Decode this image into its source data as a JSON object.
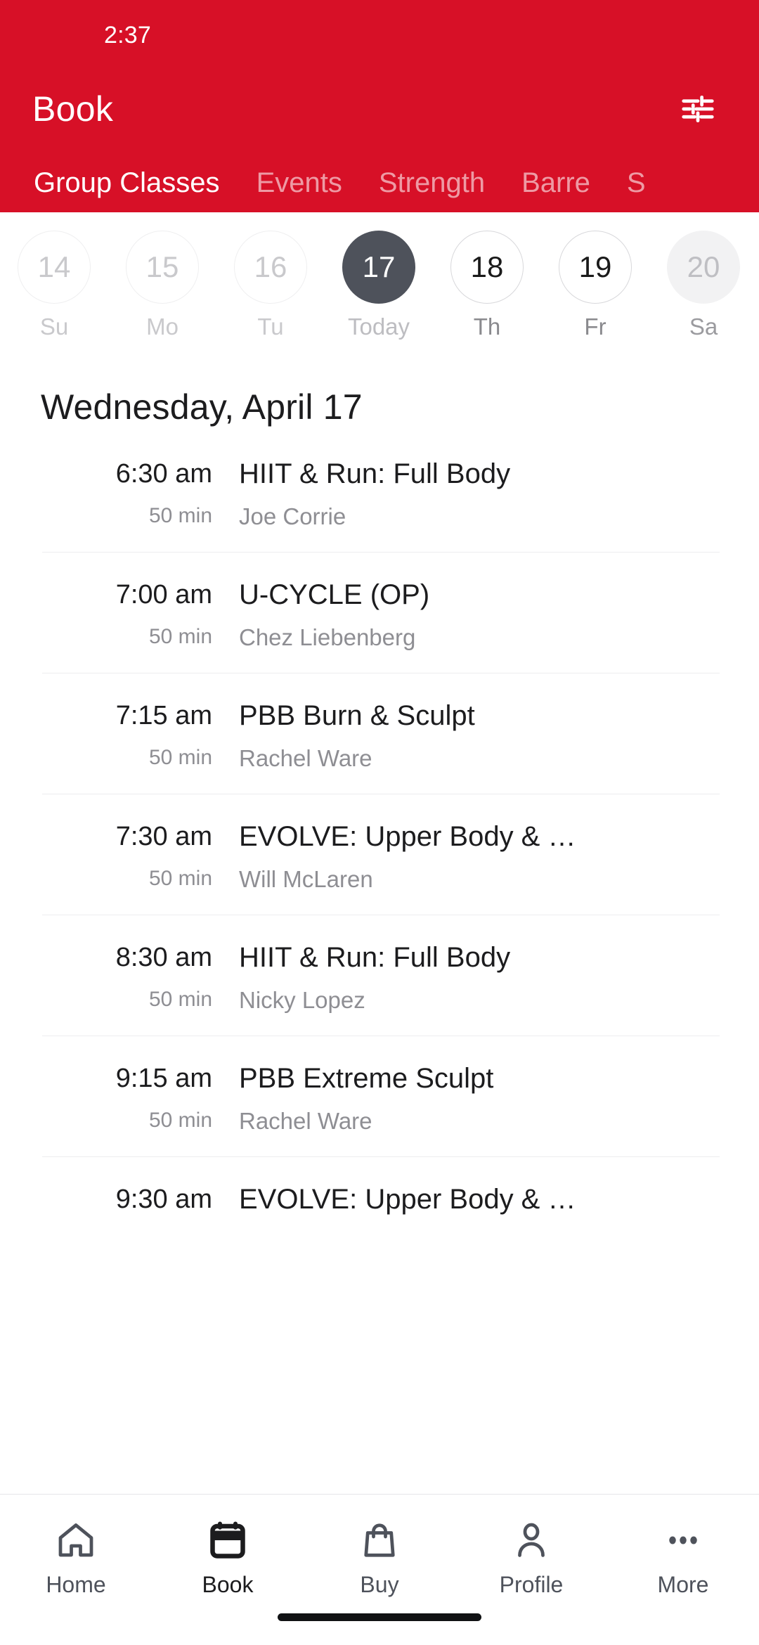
{
  "theme": {
    "brand_red": "#D71027",
    "selected_day": "#4E525B",
    "text_primary": "#1C1C1E",
    "text_secondary": "#8E8E93",
    "divider": "#EDEDEF"
  },
  "status_bar": {
    "time": "2:37"
  },
  "header": {
    "title": "Book",
    "filter_icon": "tune-icon",
    "tabs": [
      {
        "label": "Group Classes",
        "active": true
      },
      {
        "label": "Events",
        "active": false
      },
      {
        "label": "Strength",
        "active": false
      },
      {
        "label": "Barre",
        "active": false
      },
      {
        "label": "S",
        "active": false
      }
    ]
  },
  "date_strip": [
    {
      "date": "14",
      "weekday": "Su",
      "state": "past"
    },
    {
      "date": "15",
      "weekday": "Mo",
      "state": "past"
    },
    {
      "date": "16",
      "weekday": "Tu",
      "state": "past"
    },
    {
      "date": "17",
      "weekday": "Today",
      "state": "selected"
    },
    {
      "date": "18",
      "weekday": "Th",
      "state": "future"
    },
    {
      "date": "19",
      "weekday": "Fr",
      "state": "future"
    },
    {
      "date": "20",
      "weekday": "Sa",
      "state": "disabled"
    }
  ],
  "schedule": {
    "day_title": "Wednesday, April 17",
    "classes": [
      {
        "time": "6:30 am",
        "duration": "50 min",
        "name": "HIIT & Run: Full Body",
        "instructor": "Joe Corrie"
      },
      {
        "time": "7:00 am",
        "duration": "50 min",
        "name": "U-CYCLE (OP)",
        "instructor": "Chez Liebenberg"
      },
      {
        "time": "7:15 am",
        "duration": "50 min",
        "name": "PBB Burn & Sculpt",
        "instructor": "Rachel Ware"
      },
      {
        "time": "7:30 am",
        "duration": "50 min",
        "name": "EVOLVE: Upper Body & …",
        "instructor": "Will McLaren"
      },
      {
        "time": "8:30 am",
        "duration": "50 min",
        "name": "HIIT & Run: Full Body",
        "instructor": "Nicky Lopez"
      },
      {
        "time": "9:15 am",
        "duration": "50 min",
        "name": "PBB Extreme Sculpt",
        "instructor": "Rachel Ware"
      },
      {
        "time": "9:30 am",
        "duration": "",
        "name": "EVOLVE: Upper Body & …",
        "instructor": ""
      }
    ]
  },
  "bottom_nav": [
    {
      "label": "Home",
      "icon": "home-icon",
      "active": false
    },
    {
      "label": "Book",
      "icon": "calendar-icon",
      "active": true
    },
    {
      "label": "Buy",
      "icon": "shopping-bag-icon",
      "active": false
    },
    {
      "label": "Profile",
      "icon": "person-icon",
      "active": false
    },
    {
      "label": "More",
      "icon": "ellipsis-icon",
      "active": false
    }
  ]
}
